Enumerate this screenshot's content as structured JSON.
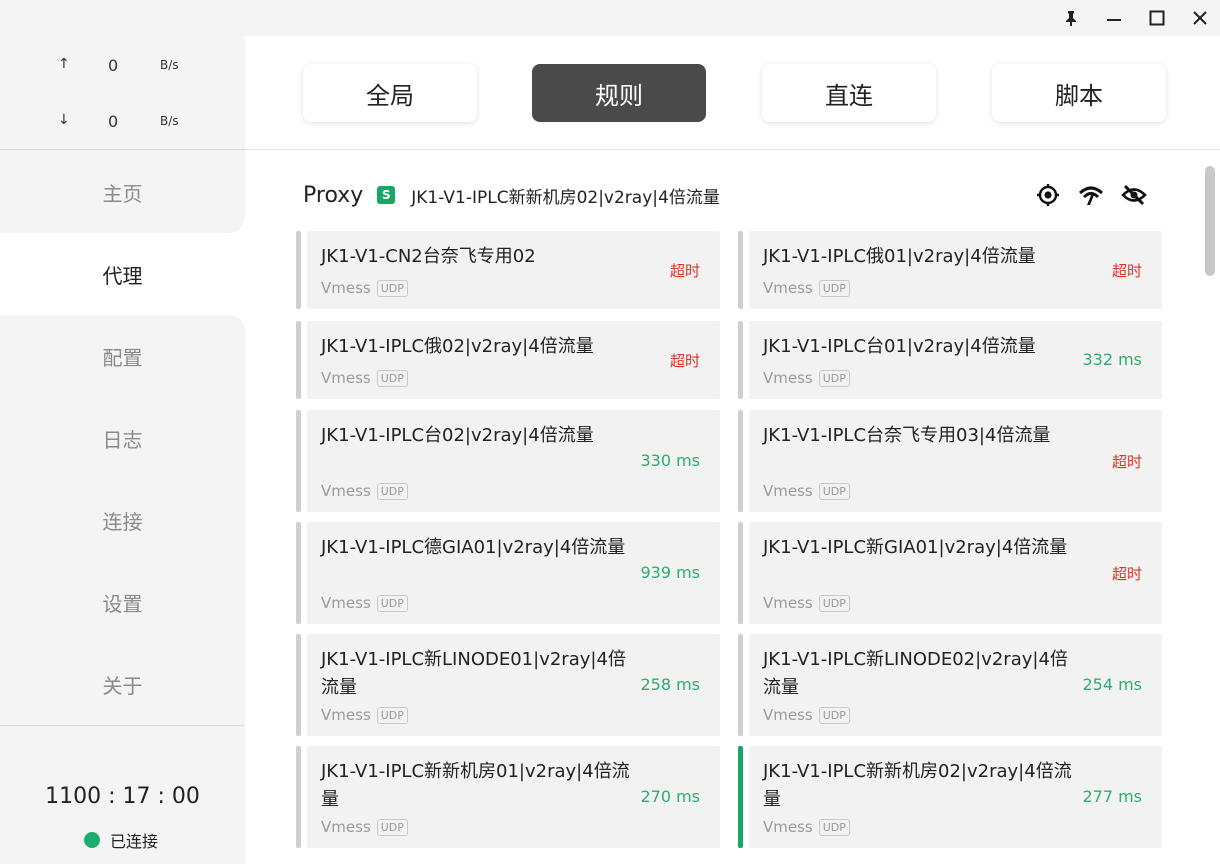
{
  "window": {
    "controls": [
      "pin-icon",
      "minimize-icon",
      "maximize-icon",
      "close-icon"
    ]
  },
  "traffic": {
    "up_arrow": "↑",
    "up_value": "0",
    "up_unit": "B/s",
    "down_arrow": "↓",
    "down_value": "0",
    "down_unit": "B/s"
  },
  "nav": {
    "items": [
      "主页",
      "代理",
      "配置",
      "日志",
      "连接",
      "设置",
      "关于"
    ],
    "active": "代理"
  },
  "footer": {
    "timer": "1100 : 17 : 00",
    "status": "已连接",
    "status_color": "#1dab6e"
  },
  "modes": {
    "items": [
      "全局",
      "规则",
      "直连",
      "脚本"
    ],
    "active": "规则"
  },
  "proxy": {
    "title": "Proxy",
    "badge": "S",
    "current": "JK1-V1-IPLC新新机房02|v2ray|4倍流量",
    "icons": [
      "locate-icon",
      "wifi-test-icon",
      "eye-off-icon"
    ]
  },
  "cards": [
    {
      "name": "JK1-V1-CN2台奈飞专用02",
      "type": "Vmess",
      "udp": "UDP",
      "delay": "超时",
      "status": "timeout"
    },
    {
      "name": "JK1-V1-IPLC俄01|v2ray|4倍流量",
      "type": "Vmess",
      "udp": "UDP",
      "delay": "超时",
      "status": "timeout"
    },
    {
      "name": "JK1-V1-IPLC俄02|v2ray|4倍流量",
      "type": "Vmess",
      "udp": "UDP",
      "delay": "超时",
      "status": "timeout"
    },
    {
      "name": "JK1-V1-IPLC台01|v2ray|4倍流量",
      "type": "Vmess",
      "udp": "UDP",
      "delay": "332 ms",
      "status": "ok"
    },
    {
      "name": "JK1-V1-IPLC台02|v2ray|4倍流量",
      "type": "Vmess",
      "udp": "UDP",
      "delay": "330 ms",
      "status": "ok"
    },
    {
      "name": "JK1-V1-IPLC台奈飞专用03|4倍流量",
      "type": "Vmess",
      "udp": "UDP",
      "delay": "超时",
      "status": "timeout"
    },
    {
      "name": "JK1-V1-IPLC德GIA01|v2ray|4倍流量",
      "type": "Vmess",
      "udp": "UDP",
      "delay": "939 ms",
      "status": "ok"
    },
    {
      "name": "JK1-V1-IPLC新GIA01|v2ray|4倍流量",
      "type": "Vmess",
      "udp": "UDP",
      "delay": "超时",
      "status": "timeout"
    },
    {
      "name": "JK1-V1-IPLC新LINODE01|v2ray|4倍流量",
      "type": "Vmess",
      "udp": "UDP",
      "delay": "258 ms",
      "status": "ok"
    },
    {
      "name": "JK1-V1-IPLC新LINODE02|v2ray|4倍流量",
      "type": "Vmess",
      "udp": "UDP",
      "delay": "254 ms",
      "status": "ok"
    },
    {
      "name": "JK1-V1-IPLC新新机房01|v2ray|4倍流量",
      "type": "Vmess",
      "udp": "UDP",
      "delay": "270 ms",
      "status": "ok"
    },
    {
      "name": "JK1-V1-IPLC新新机房02|v2ray|4倍流量",
      "type": "Vmess",
      "udp": "UDP",
      "delay": "277 ms",
      "status": "ok",
      "selected": true
    }
  ],
  "colors": {
    "accent": "#18a866",
    "timeout": "#e0312c",
    "ok": "#2eae6c",
    "active_mode": "#4a4a4a"
  }
}
